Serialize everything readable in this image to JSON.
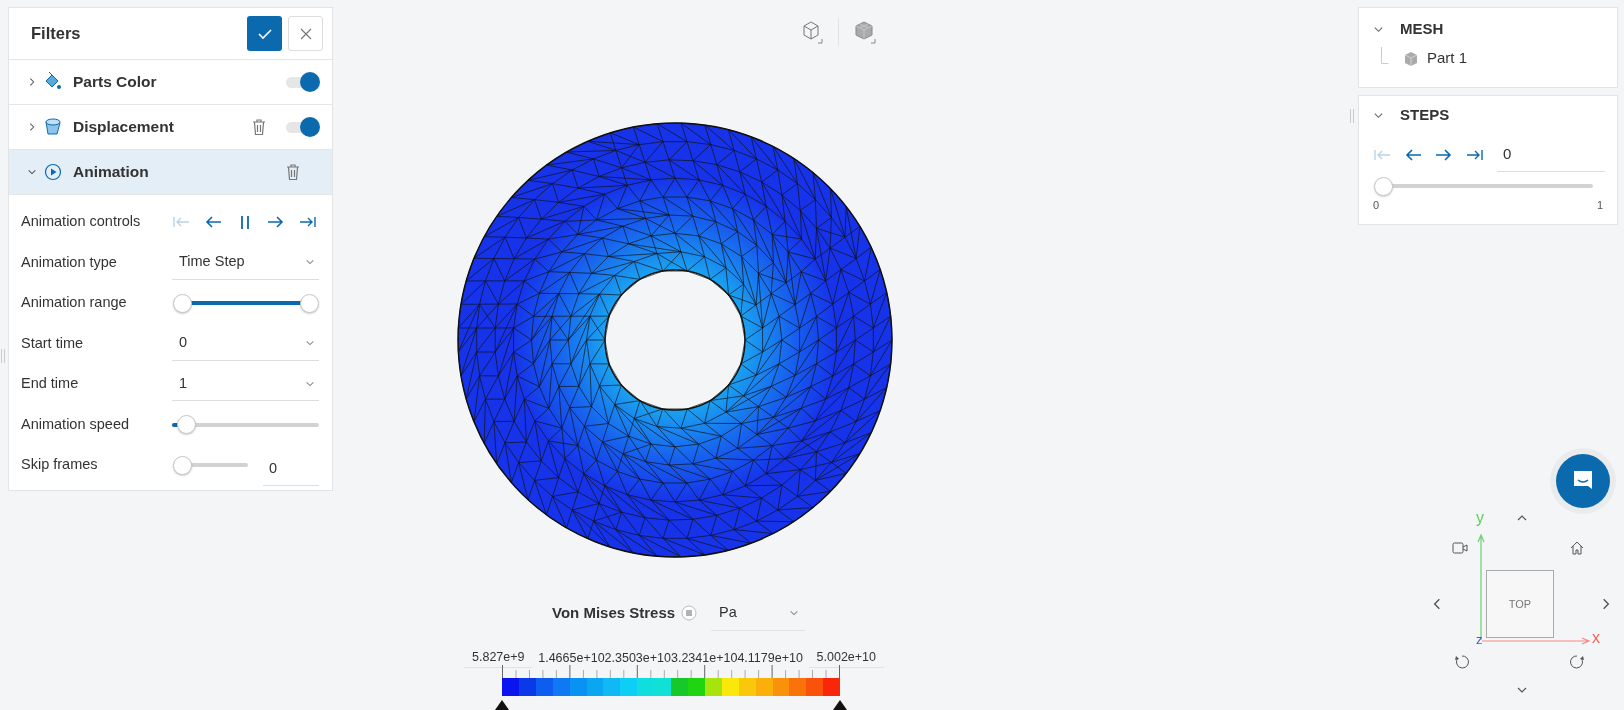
{
  "toolbar": {
    "views": [
      {
        "kind": "wireframe"
      },
      {
        "kind": "solid"
      }
    ]
  },
  "filters": {
    "title": "Filters",
    "items": [
      {
        "kind": "color",
        "label": "Parts Color",
        "expanded": false,
        "selected": false,
        "deletable": false,
        "on": true
      },
      {
        "kind": "displacement",
        "label": "Displacement",
        "expanded": false,
        "selected": false,
        "deletable": true,
        "on": true
      },
      {
        "kind": "animation",
        "label": "Animation",
        "expanded": true,
        "selected": true,
        "deletable": true
      }
    ],
    "settings": [
      {
        "kind": "controls",
        "label": "Animation controls",
        "controls": [
          {
            "kind": "first",
            "disabled": true
          },
          {
            "kind": "prev",
            "disabled": false
          },
          {
            "kind": "pause",
            "disabled": false
          },
          {
            "kind": "next",
            "disabled": false
          },
          {
            "kind": "last",
            "disabled": false
          }
        ]
      },
      {
        "kind": "select",
        "label": "Animation type",
        "value": "Time Step"
      },
      {
        "kind": "range",
        "label": "Animation range",
        "thumbs": [
          {
            "level": 0
          },
          {
            "level": 1
          }
        ]
      },
      {
        "kind": "select",
        "label": "Start time",
        "value": "0"
      },
      {
        "kind": "select",
        "label": "End time",
        "value": "1"
      },
      {
        "kind": "slider",
        "label": "Animation speed",
        "level": 0.1
      },
      {
        "kind": "slider_value",
        "label": "Skip frames",
        "level": 0,
        "value": "0"
      }
    ]
  },
  "mesh": {
    "title": "MESH",
    "expanded": true,
    "parts": [
      {
        "label": "Part 1"
      }
    ]
  },
  "steps": {
    "title": "STEPS",
    "expanded": true,
    "controls": [
      {
        "kind": "first",
        "disabled": true
      },
      {
        "kind": "prev",
        "disabled": false
      },
      {
        "kind": "next",
        "disabled": false
      },
      {
        "kind": "last",
        "disabled": false
      }
    ],
    "value": "0",
    "level": 0,
    "min": "0",
    "max": "1"
  },
  "legend": {
    "title": "Von Mises Stress",
    "unit": "Pa",
    "labels": [
      "5.827e+9",
      "1.4665e+10",
      "2.3503e+10",
      "3.2341e+10",
      "4.1179e+10",
      "5.002e+10"
    ]
  },
  "nav_cube": {
    "face": "TOP",
    "x_label": "x",
    "y_label": "y",
    "z_label": "z"
  }
}
